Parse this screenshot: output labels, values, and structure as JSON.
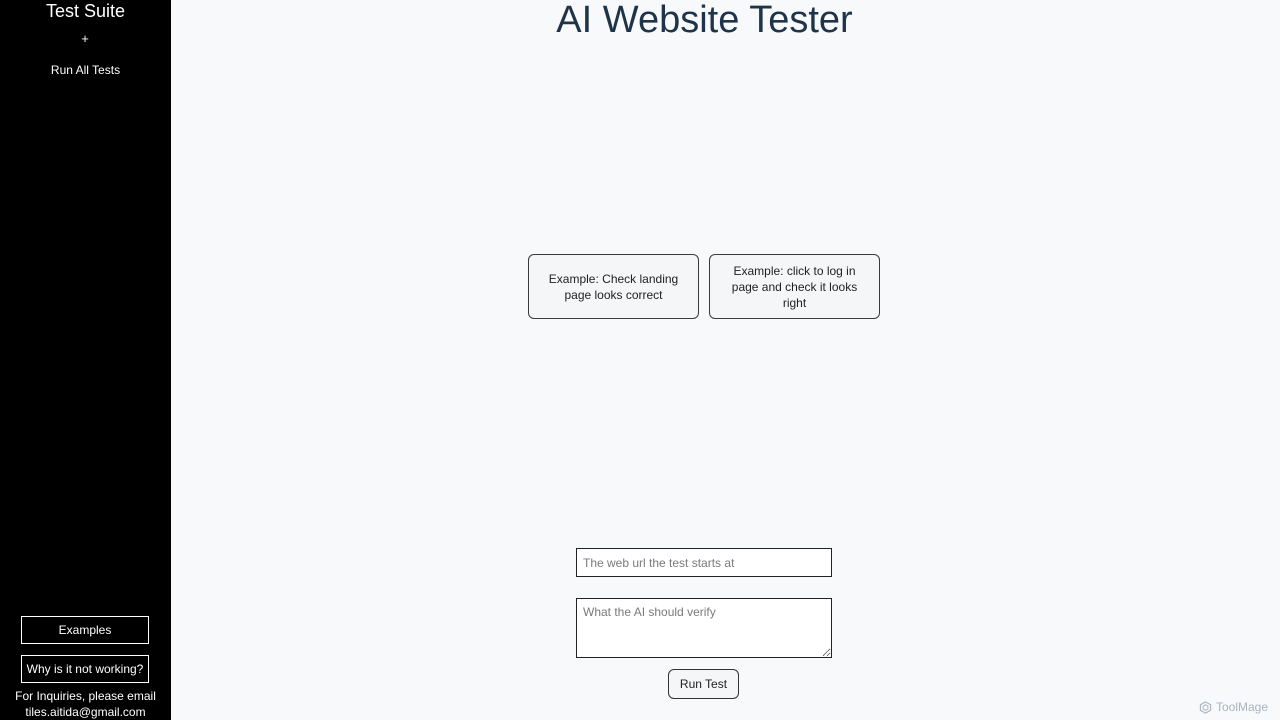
{
  "sidebar": {
    "title": "Test Suite",
    "add_label": "+",
    "run_all_label": "Run All Tests",
    "examples_label": "Examples",
    "why_label": "Why is it not working?",
    "inquiries_text": "For Inquiries, please email",
    "inquiries_email": "tiles.aitida@gmail.com"
  },
  "main": {
    "title": "AI Website Tester",
    "examples": [
      {
        "label": "Example: Check landing page looks correct"
      },
      {
        "label": "Example: click to log in page and check it looks right"
      }
    ],
    "url_placeholder": "The web url the test starts at",
    "verify_placeholder": "What the AI should verify",
    "run_test_label": "Run Test"
  },
  "watermark": {
    "text": "ToolMage",
    "icon": "hexagon-logo-icon"
  },
  "colors": {
    "sidebar_bg": "#000000",
    "page_bg": "#f8f9fa",
    "title_color": "#1f3448"
  }
}
